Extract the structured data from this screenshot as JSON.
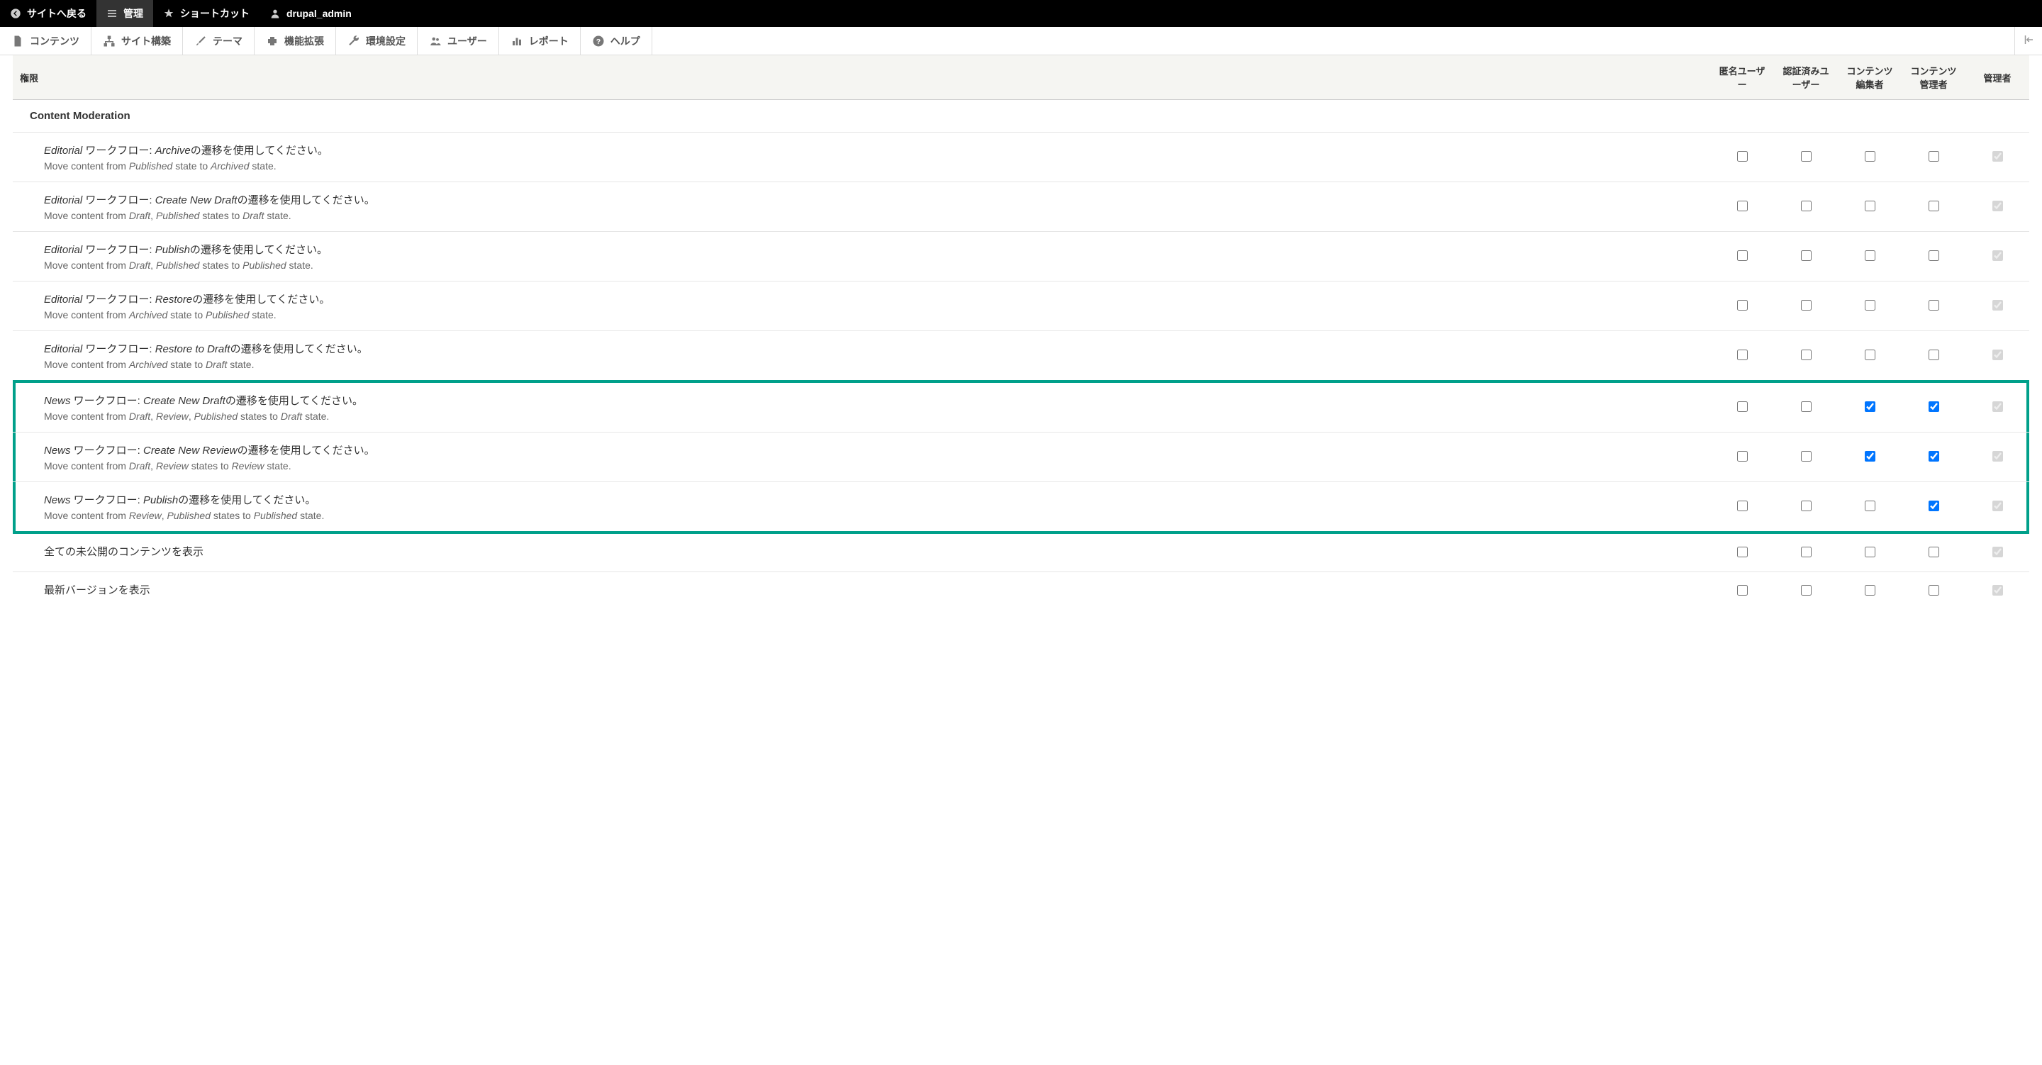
{
  "toolbar_top": {
    "back_to_site": "サイトへ戻る",
    "manage": "管理",
    "shortcuts": "ショートカット",
    "user": "drupal_admin"
  },
  "toolbar_admin": {
    "content": "コンテンツ",
    "structure": "サイト構築",
    "appearance": "テーマ",
    "extend": "機能拡張",
    "configuration": "環境設定",
    "people": "ユーザー",
    "reports": "レポート",
    "help": "ヘルプ"
  },
  "table": {
    "headers": {
      "permission": "権限",
      "anonymous": "匿名ユーザー",
      "authenticated": "認証済みユーザー",
      "content_editor": "コンテンツ編集者",
      "content_admin": "コンテンツ管理者",
      "administrator": "管理者"
    },
    "section": "Content Moderation",
    "rows": [
      {
        "title_parts": {
          "p1": "Editorial",
          "p2": " ワークフロー: ",
          "p3": "Archive",
          "p4": "の遷移を使用してください。"
        },
        "desc_parts": {
          "d1": "Move content from ",
          "d2": "Published",
          "d3": " state to ",
          "d4": "Archived",
          "d5": " state."
        },
        "checks": [
          false,
          false,
          false,
          false,
          true
        ],
        "admin_disabled": true,
        "highlight": false
      },
      {
        "title_parts": {
          "p1": "Editorial",
          "p2": " ワークフロー: ",
          "p3": "Create New Draft",
          "p4": "の遷移を使用してください。"
        },
        "desc_parts": {
          "d1": "Move content from ",
          "d2": "Draft",
          "d3": ", ",
          "d4": "Published",
          "d5": " states to ",
          "d6": "Draft",
          "d7": " state."
        },
        "checks": [
          false,
          false,
          false,
          false,
          true
        ],
        "admin_disabled": true,
        "highlight": false
      },
      {
        "title_parts": {
          "p1": "Editorial",
          "p2": " ワークフロー: ",
          "p3": "Publish",
          "p4": "の遷移を使用してください。"
        },
        "desc_parts": {
          "d1": "Move content from ",
          "d2": "Draft",
          "d3": ", ",
          "d4": "Published",
          "d5": " states to ",
          "d6": "Published",
          "d7": " state."
        },
        "checks": [
          false,
          false,
          false,
          false,
          true
        ],
        "admin_disabled": true,
        "highlight": false
      },
      {
        "title_parts": {
          "p1": "Editorial",
          "p2": " ワークフロー: ",
          "p3": "Restore",
          "p4": "の遷移を使用してください。"
        },
        "desc_parts": {
          "d1": "Move content from ",
          "d2": "Archived",
          "d3": " state to ",
          "d4": "Published",
          "d5": " state."
        },
        "checks": [
          false,
          false,
          false,
          false,
          true
        ],
        "admin_disabled": true,
        "highlight": false
      },
      {
        "title_parts": {
          "p1": "Editorial",
          "p2": " ワークフロー: ",
          "p3": "Restore to Draft",
          "p4": "の遷移を使用してください。"
        },
        "desc_parts": {
          "d1": "Move content from ",
          "d2": "Archived",
          "d3": " state to ",
          "d4": "Draft",
          "d5": " state."
        },
        "checks": [
          false,
          false,
          false,
          false,
          true
        ],
        "admin_disabled": true,
        "highlight": false
      },
      {
        "title_parts": {
          "p1": "News",
          "p2": " ワークフロー: ",
          "p3": "Create New Draft",
          "p4": "の遷移を使用してください。"
        },
        "desc_parts": {
          "d1": "Move content from ",
          "d2": "Draft",
          "d3": ", ",
          "d4": "Review",
          "d5": ", ",
          "d6": "Published",
          "d7": " states to ",
          "d8": "Draft",
          "d9": " state."
        },
        "checks": [
          false,
          false,
          true,
          true,
          true
        ],
        "admin_disabled": true,
        "highlight": "top"
      },
      {
        "title_parts": {
          "p1": "News",
          "p2": " ワークフロー: ",
          "p3": "Create New Review",
          "p4": "の遷移を使用してください。"
        },
        "desc_parts": {
          "d1": "Move content from ",
          "d2": "Draft",
          "d3": ", ",
          "d4": "Review",
          "d5": " states to ",
          "d6": "Review",
          "d7": " state."
        },
        "checks": [
          false,
          false,
          true,
          true,
          true
        ],
        "admin_disabled": true,
        "highlight": "mid"
      },
      {
        "title_parts": {
          "p1": "News",
          "p2": " ワークフロー: ",
          "p3": "Publish",
          "p4": "の遷移を使用してください。"
        },
        "desc_parts": {
          "d1": "Move content from ",
          "d2": "Review",
          "d3": ", ",
          "d4": "Published",
          "d5": " states to ",
          "d6": "Published",
          "d7": " state."
        },
        "checks": [
          false,
          false,
          false,
          true,
          true
        ],
        "admin_disabled": true,
        "highlight": "bottom"
      },
      {
        "title_plain": "全ての未公開のコンテンツを表示",
        "checks": [
          false,
          false,
          false,
          false,
          true
        ],
        "admin_disabled": true,
        "highlight": false
      },
      {
        "title_plain": "最新バージョンを表示",
        "checks": [
          false,
          false,
          false,
          false,
          true
        ],
        "admin_disabled": true,
        "highlight": false,
        "last": true
      }
    ]
  }
}
